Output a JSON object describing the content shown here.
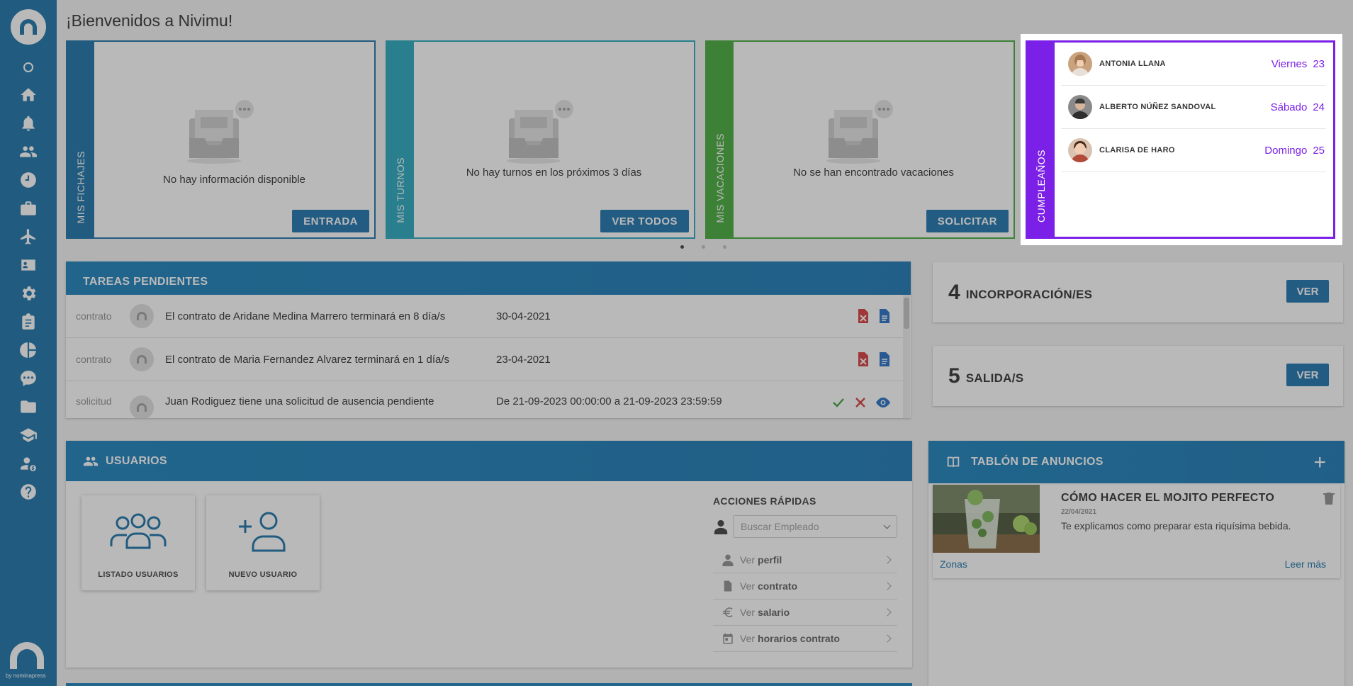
{
  "app": {
    "title": "¡Bienvenidos a Nivimu!",
    "brand_by": "by nominapress"
  },
  "colors": {
    "primary": "#0a6aa3",
    "teal": "#17a2b8",
    "green": "#37a52c",
    "purple": "#7b20e6",
    "overlay": "rgba(70,70,70,0.38)"
  },
  "sidebar": {
    "icons": [
      "home-icon",
      "bell-icon",
      "users-icon",
      "clock-icon",
      "briefcase-icon",
      "plane-icon",
      "id-card-icon",
      "gear-icon",
      "clipboard-icon",
      "pie-chart-icon",
      "chat-icon",
      "folder-icon",
      "graduation-icon",
      "user-money-icon",
      "help-icon"
    ]
  },
  "cards": {
    "fichajes": {
      "label": "MIS FICHAJES",
      "message": "No hay información disponible",
      "button": "ENTRADA"
    },
    "turnos": {
      "label": "MIS TURNOS",
      "message": "No hay turnos en los próximos 3 días",
      "button": "VER TODOS"
    },
    "vacaciones": {
      "label": "MIS VACACIONES",
      "message": "No se han encontrado vacaciones",
      "button": "SOLICITAR"
    },
    "cumpleanos": {
      "label": "CUMPLEAÑOS",
      "people": [
        {
          "name": "ANTONIA LLANA",
          "day": "Viernes",
          "date": "23"
        },
        {
          "name": "ALBERTO NÚÑEZ SANDOVAL",
          "day": "Sábado",
          "date": "24"
        },
        {
          "name": "CLARISA DE HARO",
          "day": "Domingo",
          "date": "25"
        }
      ]
    }
  },
  "carousel": {
    "pages": 3,
    "active": 1
  },
  "tareas": {
    "title": "TAREAS PENDIENTES",
    "rows": [
      {
        "type": "contrato",
        "text": "El contrato de Aridane Medina Marrero terminará en 8 día/s",
        "date": "30-04-2021",
        "actions": [
          "delete-doc-icon",
          "document-icon"
        ]
      },
      {
        "type": "contrato",
        "text": "El contrato de Maria Fernandez Alvarez terminará en 1 día/s",
        "date": "23-04-2021",
        "actions": [
          "delete-doc-icon",
          "document-icon"
        ]
      },
      {
        "type": "solicitud",
        "text": "Juan Rodiguez tiene una solicitud de ausencia pendiente",
        "date": "De 21-09-2023 00:00:00 a 21-09-2023 23:59:59",
        "actions": [
          "check-icon",
          "close-icon",
          "eye-icon"
        ]
      }
    ]
  },
  "usuarios": {
    "title": "USUARIOS",
    "tiles": [
      {
        "label": "LISTADO USUARIOS",
        "icon": "users-group-icon"
      },
      {
        "label": "NUEVO USUARIO",
        "icon": "add-user-icon"
      }
    ],
    "acciones": {
      "title": "ACCIONES RÁPIDAS",
      "search_placeholder": "Buscar Empleado",
      "items": [
        {
          "prefix": "Ver",
          "bold": "perfil",
          "icon": "user-icon"
        },
        {
          "prefix": "Ver",
          "bold": "contrato",
          "icon": "document-icon"
        },
        {
          "prefix": "Ver",
          "bold": "salario",
          "icon": "euro-icon"
        },
        {
          "prefix": "Ver",
          "bold": "horarios contrato",
          "icon": "calendar-icon"
        }
      ]
    }
  },
  "stats": {
    "incorporaciones": {
      "count": "4",
      "label": "INCORPORACIÓN/ES",
      "button": "VER"
    },
    "salidas": {
      "count": "5",
      "label": "SALIDA/S",
      "button": "VER"
    }
  },
  "tablon": {
    "title": "TABLÓN DE ANUNCIOS",
    "add": "+",
    "anuncio": {
      "title": "CÓMO HACER EL MOJITO PERFECTO",
      "date": "22/04/2021",
      "description": "Te explicamos como preparar esta riquísima bebida.",
      "tag": "Zonas",
      "more": "Leer más"
    }
  }
}
